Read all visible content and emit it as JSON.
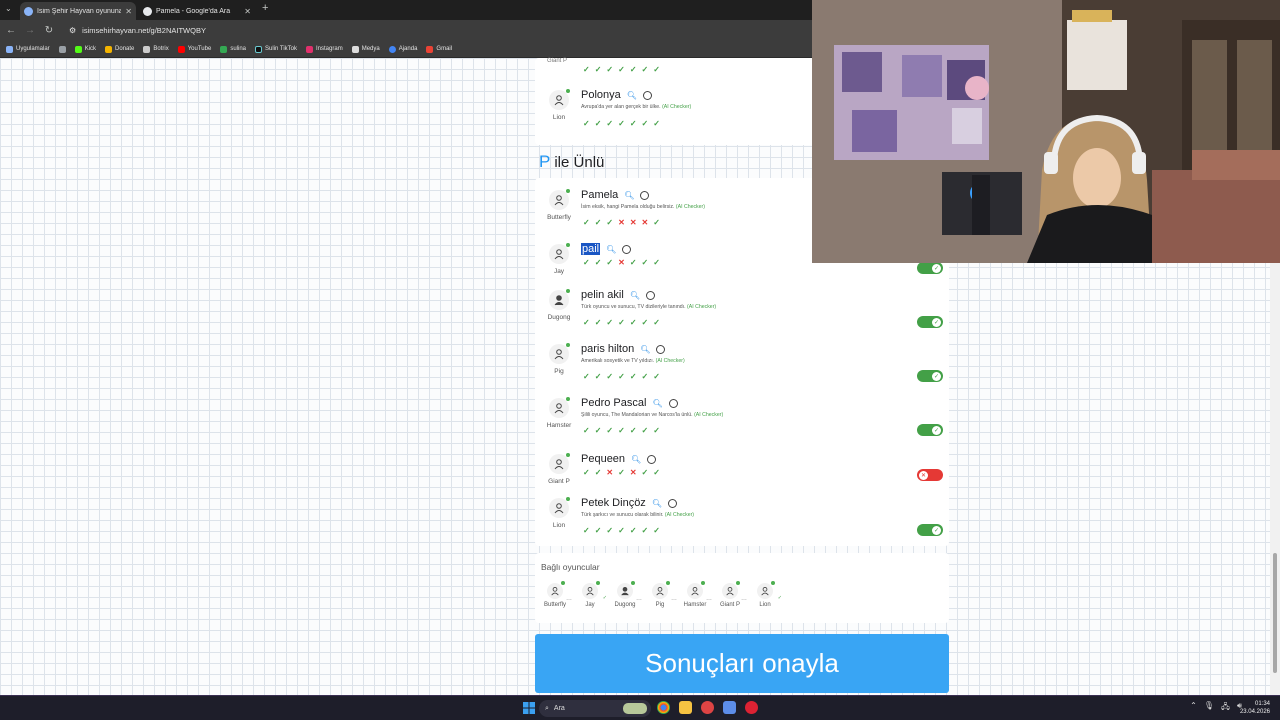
{
  "browser": {
    "tabs": [
      {
        "title": "İsim Şehir Hayvan oyununa kat",
        "active": true
      },
      {
        "title": "Pamela - Google'da Ara",
        "active": false
      }
    ],
    "url": "isimsehirhayvan.net/g/B2NAITWQBY",
    "bookmarks": [
      "Uygulamalar",
      "Kick",
      "Donate",
      "Botrix",
      "YouTube",
      "sulina",
      "Sulin TikTok",
      "Instagram",
      "Medya",
      "Ajanda",
      "Gmail"
    ]
  },
  "top_card": {
    "partial_player": "Giant P",
    "entry": {
      "player": "Lion",
      "answer": "Polonya",
      "note": "Avrupa'da yer alan gerçek bir ülke.",
      "ai_label": "(AI Checker)",
      "votes": [
        "ok",
        "ok",
        "ok",
        "ok",
        "ok",
        "ok",
        "ok"
      ]
    }
  },
  "section": {
    "letter": "P",
    "title": "ile Ünlü"
  },
  "entries": [
    {
      "player": "Butterfly",
      "answer": "Pamela",
      "note": "İsim eksik, hangi Pamela olduğu belirsiz.",
      "ai_label": "(AI Checker)",
      "votes": [
        "ok",
        "ok",
        "ok",
        "no",
        "no",
        "no",
        "ok"
      ],
      "toggle": ""
    },
    {
      "player": "Jay",
      "answer": "pail",
      "note": "",
      "ai_label": "",
      "votes": [
        "ok",
        "ok",
        "ok",
        "no",
        "ok",
        "ok",
        "ok"
      ],
      "toggle": "on"
    },
    {
      "player": "Dugong",
      "answer": "pelin akil",
      "note": "Türk oyuncu ve sunucu, TV dizileriyle tanındı.",
      "ai_label": "(AI Checker)",
      "votes": [
        "ok",
        "ok",
        "ok",
        "ok",
        "ok",
        "ok",
        "ok"
      ],
      "toggle": "on"
    },
    {
      "player": "Pig",
      "answer": "paris hilton",
      "note": "Amerikalı sosyetik ve TV yıldızı.",
      "ai_label": "(AI Checker)",
      "votes": [
        "ok",
        "ok",
        "ok",
        "ok",
        "ok",
        "ok",
        "ok"
      ],
      "toggle": "on"
    },
    {
      "player": "Hamster",
      "answer": "Pedro Pascal",
      "note": "Şilili oyuncu, The Mandalorian ve Narcos'la ünlü.",
      "ai_label": "(AI Checker)",
      "votes": [
        "ok",
        "ok",
        "ok",
        "ok",
        "ok",
        "ok",
        "ok"
      ],
      "toggle": "on"
    },
    {
      "player": "Giant P",
      "answer": "Pequeen",
      "note": "",
      "ai_label": "",
      "votes": [
        "ok",
        "ok",
        "no",
        "ok",
        "no",
        "ok",
        "ok"
      ],
      "toggle": "off"
    },
    {
      "player": "Lion",
      "answer": "Petek Dinçöz",
      "note": "Türk şarkıcı ve sunucu olarak bilinir.",
      "ai_label": "(AI Checker)",
      "votes": [
        "ok",
        "ok",
        "ok",
        "ok",
        "ok",
        "ok",
        "ok"
      ],
      "toggle": "on"
    }
  ],
  "connected": {
    "title": "Bağlı oyuncular",
    "players": [
      "Butterfly",
      "Jay",
      "Dugong",
      "Pig",
      "Hamster",
      "Giant P",
      "Lion"
    ]
  },
  "confirm_label": "Sonuçları onayla",
  "taskbar": {
    "search_placeholder": "Ara",
    "time": "01:34",
    "date": "23.04.2026"
  },
  "colors": {
    "accent": "#39a5f4",
    "ok": "#43a047",
    "no": "#e53935",
    "letter": "#2196f3"
  }
}
